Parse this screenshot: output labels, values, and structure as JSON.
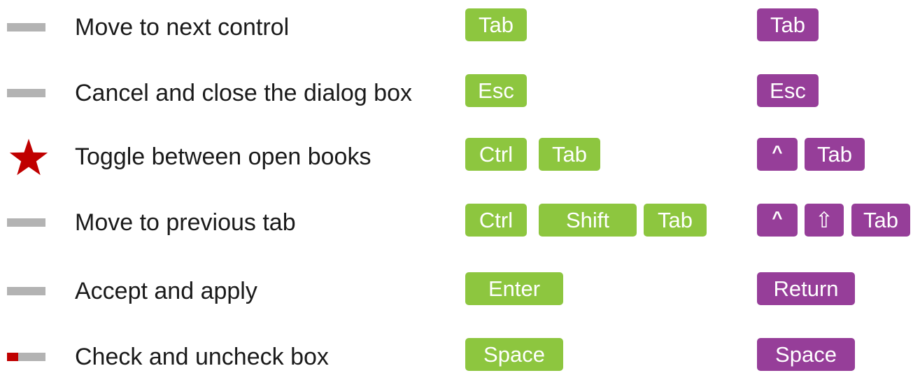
{
  "colors": {
    "windows_key": "#8dc63f",
    "mac_key": "#963e99",
    "marker_grey": "#b3b3b3",
    "marker_red": "#c00000",
    "star_red": "#c00000"
  },
  "shortcuts": [
    {
      "marker": "grey-bar",
      "label": "Move to next control",
      "windows_keys": [
        "Tab"
      ],
      "mac_keys": [
        "Tab"
      ]
    },
    {
      "marker": "grey-bar",
      "label": "Cancel and close the dialog box",
      "windows_keys": [
        "Esc"
      ],
      "mac_keys": [
        "Esc"
      ]
    },
    {
      "marker": "star-icon",
      "label": "Toggle between open books",
      "windows_keys": [
        "Ctrl",
        "Tab"
      ],
      "mac_keys": [
        "^",
        "Tab"
      ]
    },
    {
      "marker": "grey-bar",
      "label": "Move to previous tab",
      "windows_keys": [
        "Ctrl",
        "Shift",
        "Tab"
      ],
      "mac_keys": [
        "^",
        "⇧",
        "Tab"
      ]
    },
    {
      "marker": "grey-bar",
      "label": "Accept and apply",
      "windows_keys": [
        "Enter"
      ],
      "mac_keys": [
        "Return"
      ]
    },
    {
      "marker": "red-grey-bar",
      "label": "Check and uncheck box",
      "windows_keys": [
        "Space"
      ],
      "mac_keys": [
        "Space"
      ]
    }
  ]
}
